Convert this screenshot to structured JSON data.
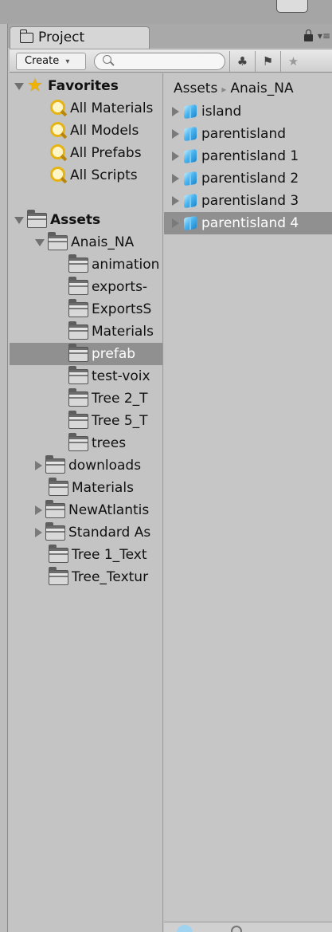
{
  "window": {
    "tab_title": "Project",
    "tab_icon": "folder-icon"
  },
  "toolbar": {
    "create_label": "Create",
    "create_dropdown_glyph": "▾",
    "search_placeholder": "",
    "filter_by_type_icon": "filter-type-icon",
    "filter_by_label_icon": "label-tag-icon",
    "favorite_icon": "star-icon",
    "lock_icon": "lock-icon",
    "menu_icon": "panel-menu-icon",
    "favorite_glyph": "★",
    "label_glyph": "⚑",
    "filter_glyph": "♣",
    "menu_glyph": "▾≡"
  },
  "tree": {
    "favorites": {
      "label": "Favorites",
      "items": [
        "All Materials",
        "All Models",
        "All Prefabs",
        "All Scripts"
      ]
    },
    "assets": {
      "label": "Assets",
      "anais": {
        "label": "Anais_NA",
        "children": [
          "animation",
          "exports-",
          "ExportsS",
          "Materials",
          "prefab",
          "test-voix",
          "Tree 2_T",
          "Tree 5_T",
          "trees"
        ],
        "selected": "prefab"
      },
      "root_items": [
        {
          "label": "downloads",
          "expandable": true
        },
        {
          "label": "Materials",
          "expandable": false
        },
        {
          "label": "NewAtlantis",
          "expandable": true
        },
        {
          "label": "Standard As",
          "expandable": true
        },
        {
          "label": "Tree 1_Text",
          "expandable": false
        },
        {
          "label": "Tree_Textur",
          "expandable": false
        }
      ]
    }
  },
  "content": {
    "breadcrumb": [
      "Assets",
      "Anais_NA"
    ],
    "breadcrumb_sep": "▸",
    "items": [
      "island",
      "parentisland",
      "parentisland 1",
      "parentisland 2",
      "parentisland 3",
      "parentisland 4"
    ],
    "selected": "parentisland 4"
  },
  "colors": {
    "selection": "#909090",
    "panel": "#c4c4c4",
    "star": "#f0b400",
    "prefab_blue": "#4cb6f0"
  }
}
